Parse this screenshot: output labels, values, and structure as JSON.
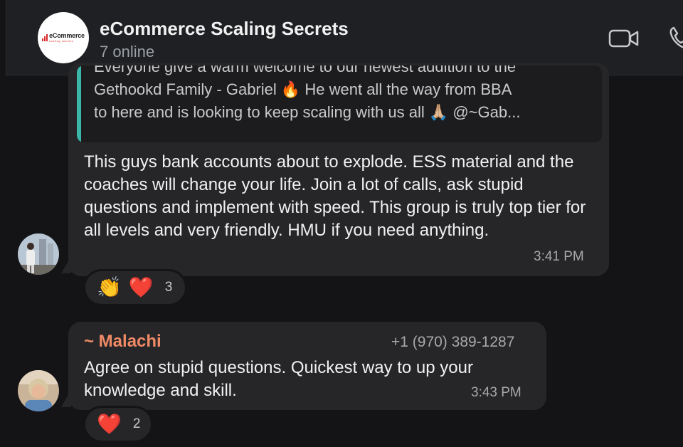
{
  "header": {
    "title": "eCommerce Scaling Secrets",
    "subtitle": "7 online",
    "logo_main": "eCommerce",
    "logo_sub": "scaling secrets",
    "video_icon": "video-camera-icon",
    "phone_icon": "phone-icon"
  },
  "message1": {
    "quote_lines": [
      "Everyone give a warm welcome to our newest addition to the",
      "Gethookd Family - Gabriel 🔥 He went all the way from BBA",
      "to here and is looking to keep scaling with us all 🙏🏼 @~Gab..."
    ],
    "text": "This guys bank accounts about to explode. ESS material and the coaches will change your life.  Join a lot of calls, ask stupid questions and implement with speed. This group is truly top tier for all levels and very friendly. HMU if you need anything.",
    "time": "3:41 PM",
    "reactions": {
      "emojis": [
        "👏",
        "❤️"
      ],
      "count": "3"
    }
  },
  "message2": {
    "sender": "~ Malachi",
    "phone": "+1 (970) 389-1287",
    "text": "Agree on stupid questions. Quickest way to up your knowledge and skill.",
    "time": "3:43 PM",
    "reactions": {
      "emojis": [
        "❤️"
      ],
      "count": "2"
    }
  },
  "colors": {
    "background": "#141416",
    "header": "#1f2023",
    "bubble": "#262628",
    "quote_accent": "#3ab7a8",
    "sender_name": "#f08a66",
    "logo_red": "#d62b2b"
  }
}
